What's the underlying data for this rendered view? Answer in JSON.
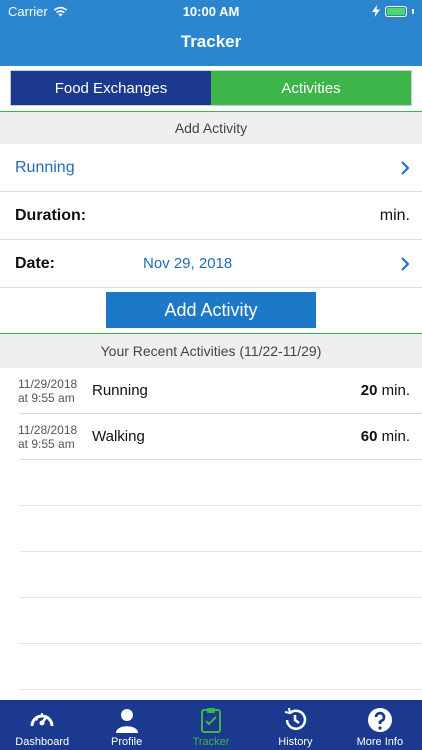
{
  "status_bar": {
    "carrier": "Carrier",
    "time": "10:00 AM"
  },
  "header": {
    "title": "Tracker"
  },
  "tabs": {
    "food": "Food Exchanges",
    "activities": "Activities"
  },
  "add_section": {
    "heading": "Add Activity",
    "activity": "Running",
    "duration_label": "Duration:",
    "duration_unit": "min.",
    "date_label": "Date:",
    "date_value": "Nov 29, 2018",
    "button": "Add Activity"
  },
  "recent": {
    "heading": "Your Recent Activities  (11/22-11/29)",
    "items": [
      {
        "date": "11/29/2018",
        "time": "at 9:55 am",
        "name": "Running",
        "duration": "20",
        "unit": "min."
      },
      {
        "date": "11/28/2018",
        "time": "at 9:55 am",
        "name": "Walking",
        "duration": "60",
        "unit": "min."
      }
    ]
  },
  "tabbar": {
    "dashboard": "Dashboard",
    "profile": "Profile",
    "tracker": "Tracker",
    "history": "History",
    "more": "More Info"
  },
  "colors": {
    "header": "#2b85cf",
    "food_tab": "#1b3a8f",
    "activities_tab": "#3db54a",
    "link": "#1f6bb5",
    "button": "#1e78c8",
    "tabbar": "#1b3a8f",
    "tab_active": "#3db54a"
  },
  "icons": {
    "wifi": "wifi-icon",
    "battery": "battery-icon",
    "chevron": "chevron-right-icon",
    "dashboard": "speedometer-icon",
    "profile": "person-icon",
    "tracker": "clipboard-icon",
    "history": "history-clock-icon",
    "more": "question-icon"
  }
}
